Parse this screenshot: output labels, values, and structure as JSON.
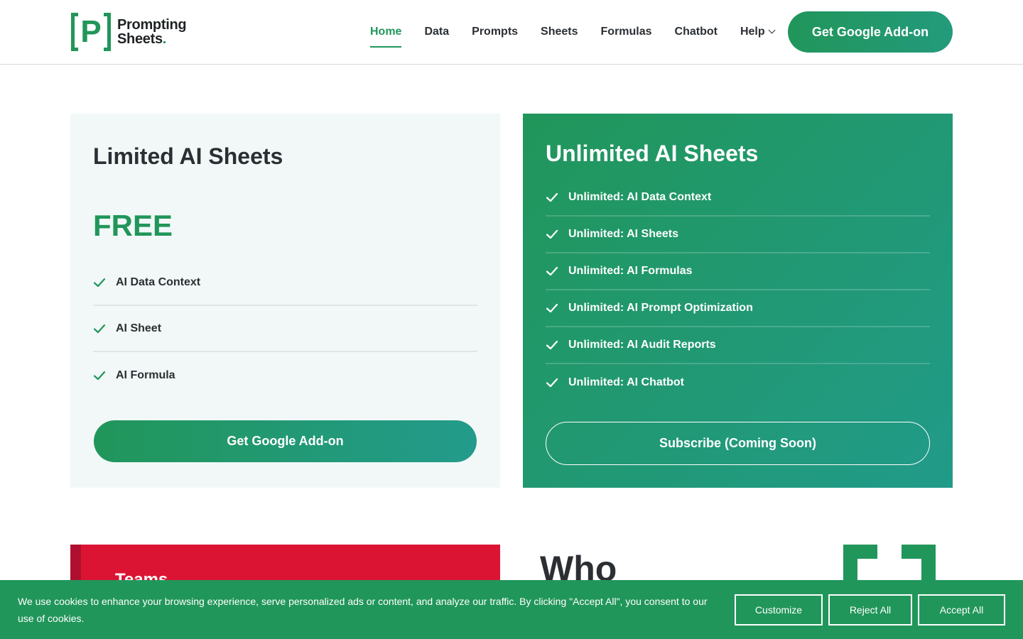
{
  "brand": {
    "line1": "Prompting",
    "line2": "Sheets",
    "dot": ".",
    "mark_letter": "P",
    "color": "#21965a"
  },
  "nav": {
    "items": [
      "Home",
      "Data",
      "Prompts",
      "Sheets",
      "Formulas",
      "Chatbot",
      "Help"
    ],
    "active": "Home",
    "cta": "Get Google Add-on"
  },
  "free_plan": {
    "title": "Limited AI Sheets",
    "price": "FREE",
    "features": [
      "AI Data Context",
      "AI Sheet",
      "AI Formula"
    ],
    "cta": "Get Google Add-on"
  },
  "unlimited_plan": {
    "title": "Unlimited AI Sheets",
    "features": [
      "Unlimited: AI Data Context",
      "Unlimited: AI Sheets",
      "Unlimited: AI Formulas",
      "Unlimited: AI Prompt Optimization",
      "Unlimited: AI Audit Reports",
      "Unlimited: AI Chatbot"
    ],
    "cta": "Subscribe (Coming Soon)"
  },
  "lower": {
    "teams_label": "Teams",
    "who_heading": "Who"
  },
  "cookie": {
    "text": "We use cookies to enhance your browsing experience, serve personalized ads or content, and analyze our traffic. By clicking \"Accept All\", you consent to our use of cookies.",
    "customize": "Customize",
    "reject": "Reject All",
    "accept": "Accept All"
  }
}
